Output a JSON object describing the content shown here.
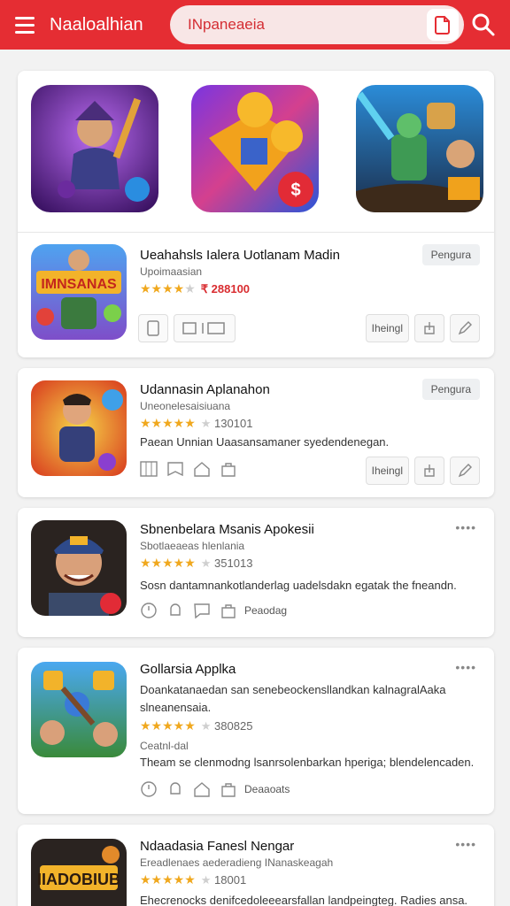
{
  "header": {
    "title": "Naaloalhian",
    "search_text": "INpaneaeia"
  },
  "featured": {
    "tiles": [
      {
        "icon": "wizard-hero-game-icon"
      },
      {
        "icon": "coins-puzzle-game-icon"
      },
      {
        "icon": "robot-battle-game-icon"
      }
    ]
  },
  "apps": [
    {
      "name": "Ueahahsls Ialera Uotlanam Madin",
      "sub": "Upoimaasian",
      "rating_text": "★★★★★",
      "price": "₹ 288100",
      "pill": "Pengura",
      "action_text": "Iheingl"
    },
    {
      "name": "Udannasin Aplanahon",
      "sub": "Uneonelesaisiuana",
      "count": "130101",
      "desc": "Paean Unnian Uaasansamaner syedendenegan.",
      "pill": "Pengura",
      "action_text": "Iheingl"
    },
    {
      "name": "Sbnenbelara Msanis Apokesii",
      "sub": "Sbotlaeaeas hlenlania",
      "count": "351013",
      "desc": "Sosn dantamnankotlanderlag uadelsdakn egatak the fneandn.",
      "dots": "••••",
      "action_text": "Peaodag"
    },
    {
      "name": "Gollarsia Applka",
      "desc1": "Doankatanaedan san senebeockensllandkan kalnagralAaka",
      "desc1b": "slneanensaia.",
      "count": "380825",
      "sub": "Ceatnl-dal",
      "desc2": "Theam se clenmodng lsanrsolenbarkan hperiga; blendelencaden.",
      "dots": "••••",
      "action_text": "Deaaoats"
    },
    {
      "name": "Ndaadasia Fanesl Nengar",
      "sub": "Ereadlenaes aederadieng INanaskeagah",
      "count": "18001",
      "desc": "Ehecrenocks denifcedoleeearsfallan landpeingteg. Radies ansa.",
      "dots": "••••"
    }
  ],
  "colors": {
    "brand_red": "#e52d33",
    "star_gold": "#f0a81e",
    "price_red": "#d92c30"
  }
}
